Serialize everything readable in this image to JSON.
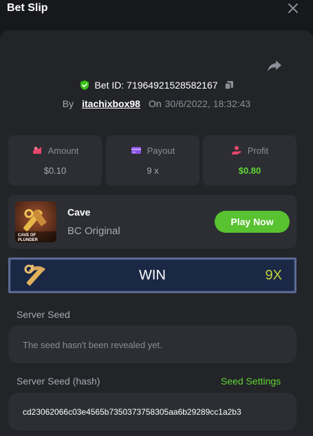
{
  "header": {
    "title": "Bet Slip",
    "close_icon": "close-icon"
  },
  "bet": {
    "id_text": "Bet ID: 71964921528582167",
    "by_label": "By",
    "username": "itachixbox98",
    "on_label": "On",
    "date": "30/6/2022, 18:32:43"
  },
  "stats": [
    {
      "label": "Amount",
      "value": "$0.10",
      "icon": "amount-icon"
    },
    {
      "label": "Payout",
      "value": "9 x",
      "icon": "payout-icon"
    },
    {
      "label": "Profit",
      "value": "$0.80",
      "icon": "profit-icon"
    }
  ],
  "game": {
    "name": "Cave",
    "subtitle": "BC Original",
    "play_label": "Play Now",
    "thumb_text": "CAVE OF PLUNDER"
  },
  "result": {
    "label": "WIN",
    "multiplier": "9X"
  },
  "server_seed": {
    "label": "Server Seed",
    "value": "The seed hasn't been revealed yet."
  },
  "server_seed_hash": {
    "label": "Server Seed (hash)",
    "settings_label": "Seed Settings",
    "value": "cd23062066c03e4565b7350373758305aa6b29289cc1a2b3"
  },
  "colors": {
    "accent_green": "#58c230",
    "profit_green": "#5ed633",
    "multiplier_yellow": "#c2d43a",
    "panel_bg": "#232428",
    "card_bg": "#2c2e33"
  }
}
